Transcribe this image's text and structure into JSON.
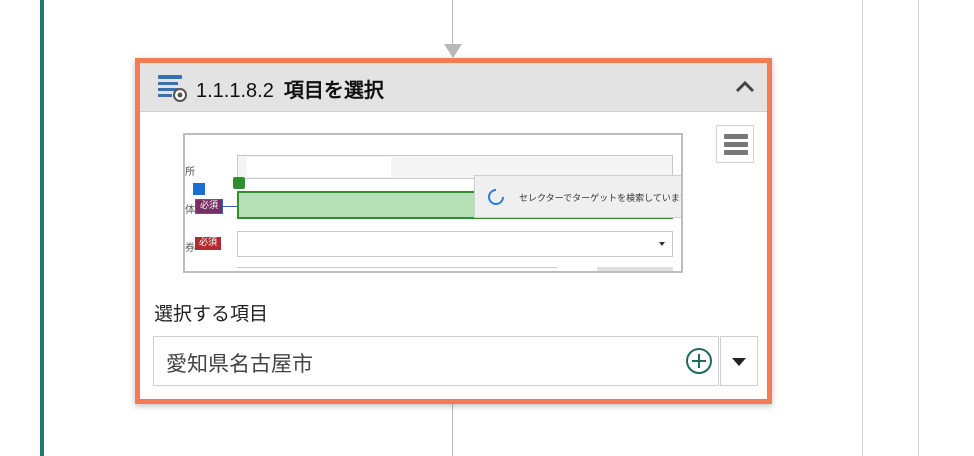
{
  "activity": {
    "number": "1.1.1.8.2",
    "title": "項目を選択"
  },
  "field": {
    "label": "選択する項目",
    "value": "愛知県名古屋市"
  },
  "screenshot": {
    "badge_required": "必須",
    "loading_text": "セレクターでターゲットを検索しています。",
    "row_labels": [
      "所",
      "体",
      "券"
    ]
  },
  "colors": {
    "card_border": "#f47c54",
    "left_rail": "#1f7a6b",
    "highlight": "#b5dfb5",
    "badge": "#b22b34"
  },
  "icons": {
    "activity": "select-item-activity-icon",
    "collapse": "chevron-up-icon",
    "menu": "hamburger-menu-icon",
    "add": "plus-circle-icon",
    "dropdown": "caret-down-icon"
  }
}
